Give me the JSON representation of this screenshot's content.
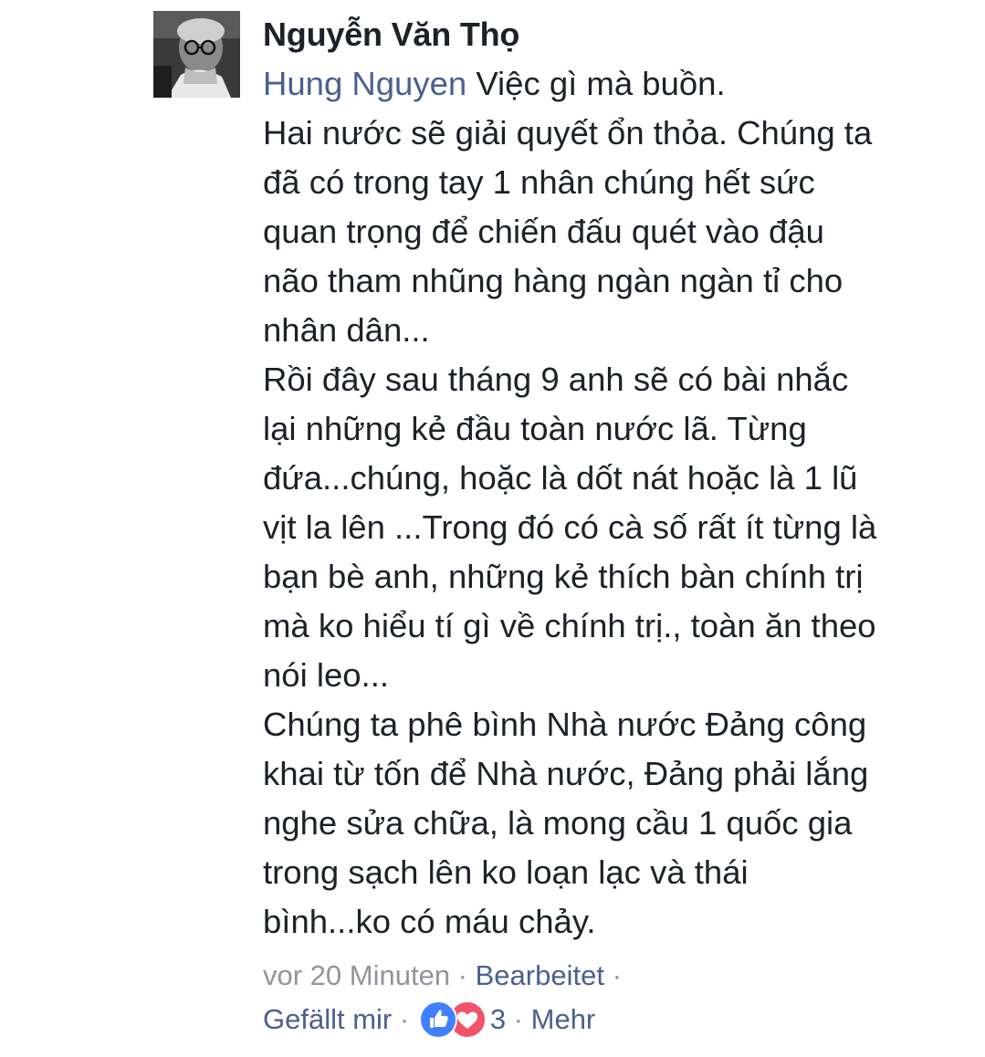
{
  "comment": {
    "author": "Nguyễn Văn Thọ",
    "mention": "Hung Nguyen",
    "lines": [
      " Việc gì mà buồn.",
      "Hai nước sẽ giải quyết ổn thỏa. Chúng ta",
      "đã có trong tay 1 nhân chúng hết sức",
      "quan trọng để chiến đấu quét vào đậu",
      "não tham nhũng hàng ngàn ngàn tỉ cho",
      "nhân dân...",
      "Rồi đây sau tháng 9 anh sẽ có bài nhắc",
      "lại những kẻ đầu toàn nước lã. Từng",
      "đứa...chúng, hoặc là dốt nát hoặc là 1 lũ",
      "vịt la lên ...Trong đó có cà số rất ít từng là",
      "bạn bè anh, những kẻ thích bàn chính trị",
      "mà ko hiểu tí gì về chính trị., toàn ăn theo",
      "nói leo...",
      "Chúng ta phê bình Nhà nước Đảng công",
      "khai từ tốn để Nhà nước, Đảng phải lắng",
      "nghe sửa chữa, là mong cầu 1 quốc gia",
      "trong sạch lên ko loạn lạc và thái",
      "bình...ko có máu chảy."
    ],
    "meta": {
      "time": "vor 20 Minuten",
      "sep1": " · ",
      "edited": "Bearbeitet",
      "sep2": " ·",
      "like": "Gefällt mir",
      "sep3": " · ",
      "reaction_count": "3",
      "sep4": " · ",
      "more": "Mehr"
    },
    "reactions": [
      "like-icon",
      "love-icon"
    ],
    "colors": {
      "text": "#1d2129",
      "link": "#4b5f8f",
      "meta": "#90949c",
      "like": "#4080ff",
      "love": "#f25268"
    }
  }
}
